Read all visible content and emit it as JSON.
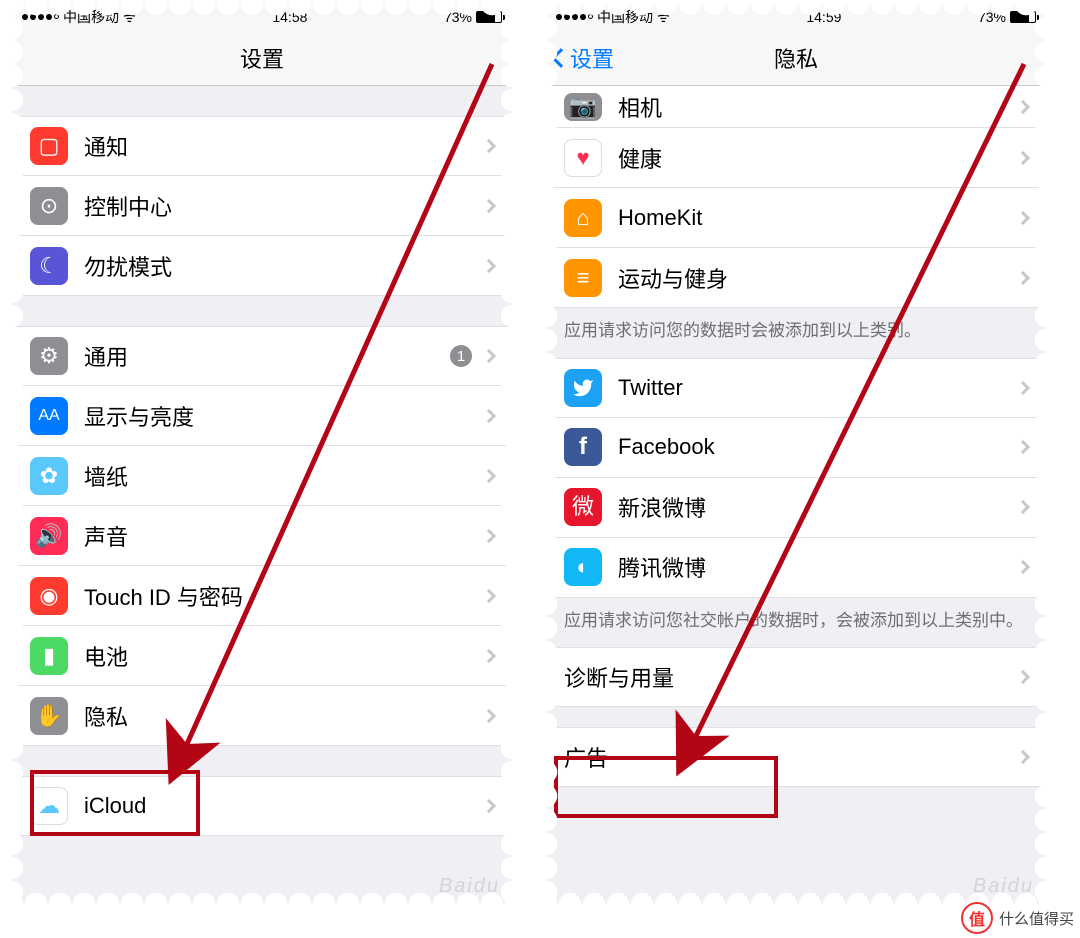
{
  "left": {
    "status": {
      "carrier": "中国移动",
      "time": "14:58",
      "battery": "73%"
    },
    "nav": {
      "title": "设置"
    },
    "rows": {
      "notifications": "通知",
      "control_center": "控制中心",
      "dnd": "勿扰模式",
      "general": "通用",
      "general_badge": "1",
      "display": "显示与亮度",
      "wallpaper": "墙纸",
      "sound": "声音",
      "touchid": "Touch ID 与密码",
      "battery": "电池",
      "privacy": "隐私",
      "icloud": "iCloud"
    }
  },
  "right": {
    "status": {
      "carrier": "中国移动",
      "time": "14:59",
      "battery": "73%"
    },
    "nav": {
      "back": "设置",
      "title": "隐私"
    },
    "rows": {
      "camera": "相机",
      "health": "健康",
      "homekit": "HomeKit",
      "motion": "运动与健身",
      "twitter": "Twitter",
      "facebook": "Facebook",
      "weibo": "新浪微博",
      "tencent": "腾讯微博",
      "diagnostics": "诊断与用量",
      "ads": "广告"
    },
    "notes": {
      "data_note": "应用请求访问您的数据时会被添加到以上类别。",
      "social_note": "应用请求访问您社交帐户的数据时，会被添加到以上类别中。"
    }
  },
  "watermark": {
    "text": "什么值得买",
    "mark": "值"
  }
}
